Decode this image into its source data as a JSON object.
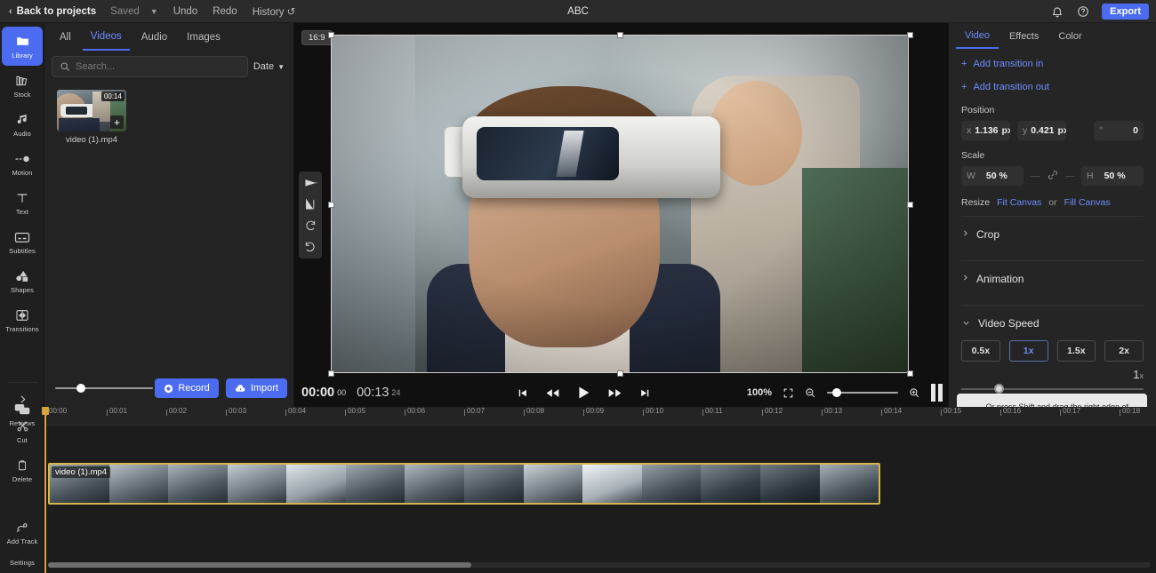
{
  "topbar": {
    "back_label": "Back to projects",
    "saved_label": "Saved",
    "undo_label": "Undo",
    "redo_label": "Redo",
    "history_label": "History",
    "project_title": "ABC",
    "bell_icon": "bell-icon",
    "help_icon": "help-circle-icon",
    "export_label": "Export"
  },
  "rail": {
    "items": [
      {
        "label": "Library",
        "icon": "folder-icon",
        "active": true
      },
      {
        "label": "Stock",
        "icon": "stock-books-icon",
        "active": false
      },
      {
        "label": "Audio",
        "icon": "music-note-icon",
        "active": false
      },
      {
        "label": "Motion",
        "icon": "motion-icon",
        "active": false
      },
      {
        "label": "Text",
        "icon": "text-t-icon",
        "active": false
      },
      {
        "label": "Subtitles",
        "icon": "subtitles-icon",
        "active": false
      },
      {
        "label": "Shapes",
        "icon": "shapes-icon",
        "active": false
      },
      {
        "label": "Transitions",
        "icon": "transitions-icon",
        "active": false
      },
      {
        "label": "Reviews",
        "icon": "comments-icon",
        "active": false
      }
    ],
    "bottom": [
      {
        "label": "",
        "icon": "chevron-right-icon"
      },
      {
        "label": "Cut",
        "icon": "scissors-icon"
      },
      {
        "label": "Delete",
        "icon": "trash-icon"
      },
      {
        "label": "Add Track",
        "icon": "add-track-icon"
      },
      {
        "label": "Settings",
        "icon": "settings-icon"
      }
    ]
  },
  "library": {
    "tabs": [
      {
        "label": "All",
        "active": false
      },
      {
        "label": "Videos",
        "active": true
      },
      {
        "label": "Audio",
        "active": false
      },
      {
        "label": "Images",
        "active": false
      }
    ],
    "search": {
      "placeholder": "Search...",
      "value": "",
      "icon": "search-icon"
    },
    "sort": {
      "label": "Date",
      "icon": "chevron-down-icon"
    },
    "media": [
      {
        "name": "video (1).mp4",
        "duration": "00:14",
        "add_label": "+"
      }
    ],
    "footer": {
      "record_label": "Record",
      "record_icon": "record-dot-icon",
      "import_label": "Import",
      "import_icon": "cloud-upload-icon",
      "volume_value": 22
    }
  },
  "stage": {
    "aspect_ratio_badge": "16:9",
    "tools": [
      {
        "icon": "flip-vertical-icon"
      },
      {
        "icon": "flip-horizontal-icon"
      },
      {
        "icon": "rotate-cw-icon"
      },
      {
        "icon": "rotate-ccw-icon"
      }
    ]
  },
  "transport": {
    "current_time": "00:00",
    "current_frames": "00",
    "total_time": "00:13",
    "total_frames": "24",
    "buttons": [
      {
        "icon": "skip-start-icon"
      },
      {
        "icon": "rewind-icon"
      },
      {
        "icon": "play-icon"
      },
      {
        "icon": "fast-forward-icon"
      },
      {
        "icon": "skip-end-icon"
      }
    ],
    "zoom_percent": "100%",
    "fullscreen_icon": "fullscreen-icon",
    "zoom_out_icon": "zoom-out-icon",
    "zoom_in_icon": "zoom-in-icon",
    "zoom_value": 8,
    "pause_icon": "pause-icon"
  },
  "inspector": {
    "tabs": [
      {
        "label": "Video",
        "active": true
      },
      {
        "label": "Effects",
        "active": false
      },
      {
        "label": "Color",
        "active": false
      }
    ],
    "transition_in": "Add transition in",
    "transition_out": "Add transition out",
    "position": {
      "label": "Position",
      "x_key": "x",
      "x_value": "1.136",
      "x_unit": "px",
      "y_key": "y",
      "y_value": "0.421",
      "y_unit": "px",
      "rotation_key": "°",
      "rotation_value": "0"
    },
    "scale": {
      "label": "Scale",
      "w_key": "W",
      "w_value": "50 %",
      "h_key": "H",
      "h_value": "50 %",
      "link_icon": "chain-link-icon"
    },
    "resize": {
      "label": "Resize",
      "fit_label": "Fit Canvas",
      "or_label": "or",
      "fill_label": "Fill Canvas"
    },
    "crop": {
      "label": "Crop",
      "icon": "chevron-right-icon"
    },
    "animation": {
      "label": "Animation",
      "icon": "chevron-right-icon"
    },
    "video_speed": {
      "label": "Video Speed",
      "icon": "chevron-down-icon",
      "presets": [
        {
          "label": "0.5x",
          "active": false
        },
        {
          "label": "1x",
          "active": true
        },
        {
          "label": "1.5x",
          "active": false
        },
        {
          "label": "2x",
          "active": false
        }
      ],
      "current_value": "1",
      "current_unit": "x",
      "slider_value": 18
    },
    "tooltip_text": "↔ Or press Shift and drag the right edge of"
  },
  "timeline": {
    "ticks": [
      "00:00",
      "00:01",
      "00:02",
      "00:03",
      "00:04",
      "00:05",
      "00:06",
      "00:07",
      "00:08",
      "00:09",
      "00:10",
      "00:11",
      "00:12",
      "00:13",
      "00:14",
      "00:15",
      "00:16",
      "00:17",
      "00:18"
    ],
    "playhead_position": 0,
    "clip": {
      "label": "video (1).mp4",
      "frames": 14
    }
  },
  "colors": {
    "accent": "#4b6cf0",
    "link": "#6e8dff",
    "clip_border": "#d8b44a",
    "playhead": "#d8a33a",
    "panel_bg": "#252525",
    "rail_bg": "#1f1f1f"
  }
}
